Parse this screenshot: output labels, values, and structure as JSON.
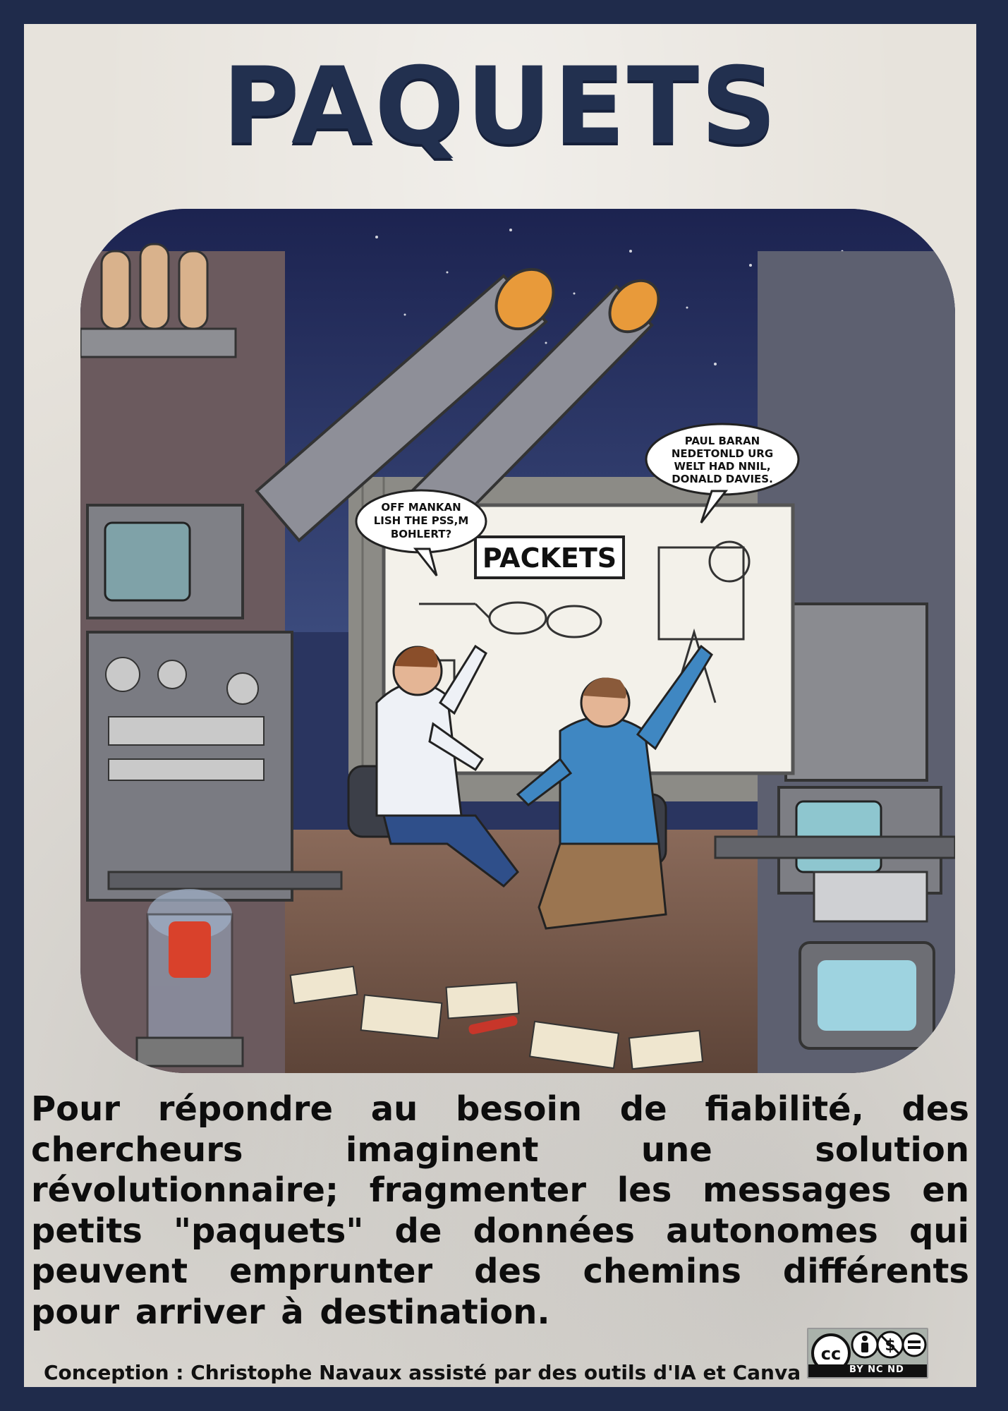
{
  "poster": {
    "title": "PAQUETS",
    "body": "Pour répondre au besoin de fiabilité, des chercheurs imaginent une solution révolutionnaire; fragmenter les messages en petits \"paquets\" de données autonomes qui peuvent emprunter des chemins différents pour arriver à destination.",
    "footer": "Conception : Christophe Navaux  assisté par des outils d'IA et Canva"
  },
  "illustration": {
    "whiteboard_title": "PACKETS",
    "bubble_left": [
      "OFF MANKAN",
      "LISH THE PSS,M",
      "BOHLERT?"
    ],
    "bubble_right": [
      "PAUL BARAN",
      "NEDETONLD URG",
      "WELT HAD NNIL,",
      "DONALD DAVIES."
    ]
  },
  "license": {
    "cc_symbol": "cc",
    "text": "BY  NC  ND"
  },
  "colors": {
    "border": "#1f2b4b",
    "paper": "#e7e3dc",
    "title": "#22304f",
    "text": "#0d0d0d"
  },
  "icons": [
    "cc-icon",
    "by-person-icon",
    "nc-dollar-icon",
    "nd-equal-icon"
  ]
}
